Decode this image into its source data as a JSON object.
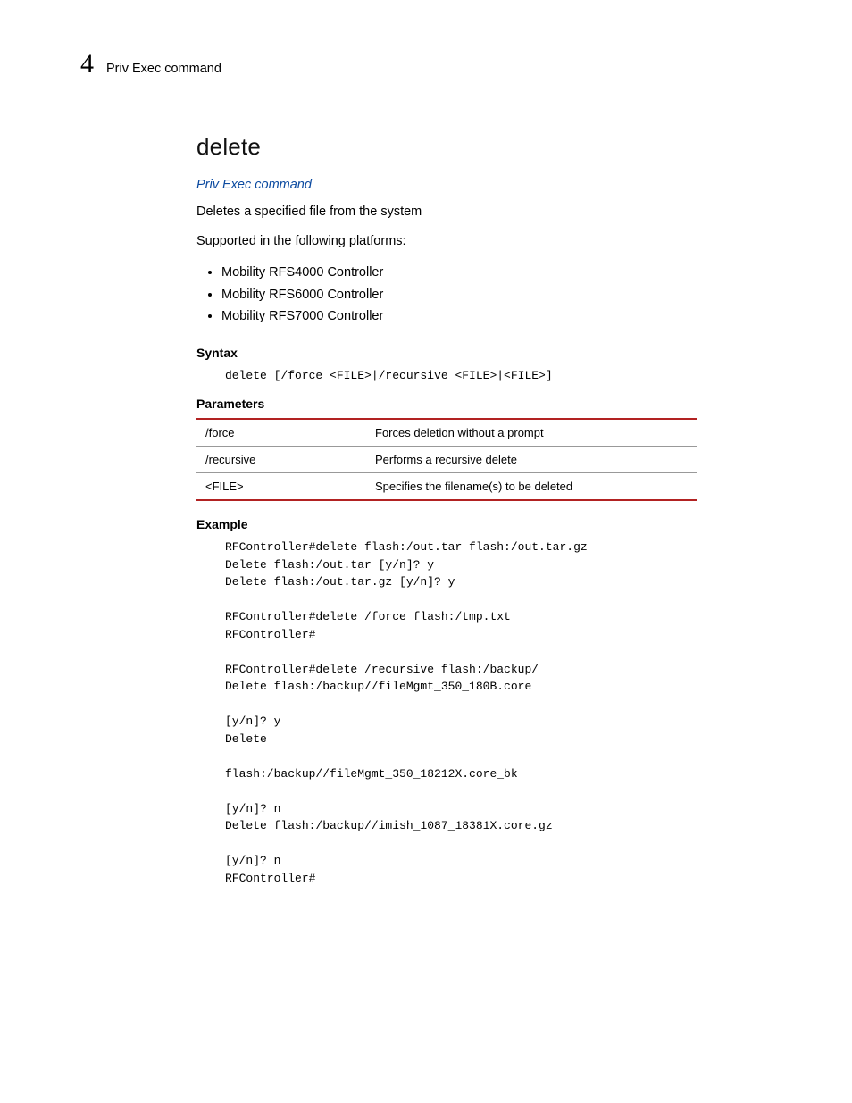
{
  "header": {
    "chapter": "4",
    "title": "Priv Exec command"
  },
  "command": {
    "name": "delete",
    "breadcrumb": "Priv Exec command",
    "desc1": "Deletes a specified file from the system",
    "desc2": "Supported in the following platforms:",
    "platforms": [
      "Mobility RFS4000 Controller",
      "Mobility RFS6000 Controller",
      "Mobility RFS7000 Controller"
    ],
    "syntax_label": "Syntax",
    "syntax_code": "delete [/force <FILE>|/recursive <FILE>|<FILE>]",
    "params_label": "Parameters",
    "params": [
      {
        "name": "/force",
        "desc": "Forces deletion without a prompt"
      },
      {
        "name": "/recursive",
        "desc": "Performs a recursive delete"
      },
      {
        "name": "<FILE>",
        "desc": "Specifies the filename(s) to be deleted"
      }
    ],
    "example_label": "Example",
    "example_code": "RFController#delete flash:/out.tar flash:/out.tar.gz\nDelete flash:/out.tar [y/n]? y\nDelete flash:/out.tar.gz [y/n]? y\n\nRFController#delete /force flash:/tmp.txt\nRFController#\n\nRFController#delete /recursive flash:/backup/\nDelete flash:/backup//fileMgmt_350_180B.core\n\n[y/n]? y\nDelete \n\nflash:/backup//fileMgmt_350_18212X.core_bk\n\n[y/n]? n\nDelete flash:/backup//imish_1087_18381X.core.gz\n\n[y/n]? n\nRFController#"
  }
}
